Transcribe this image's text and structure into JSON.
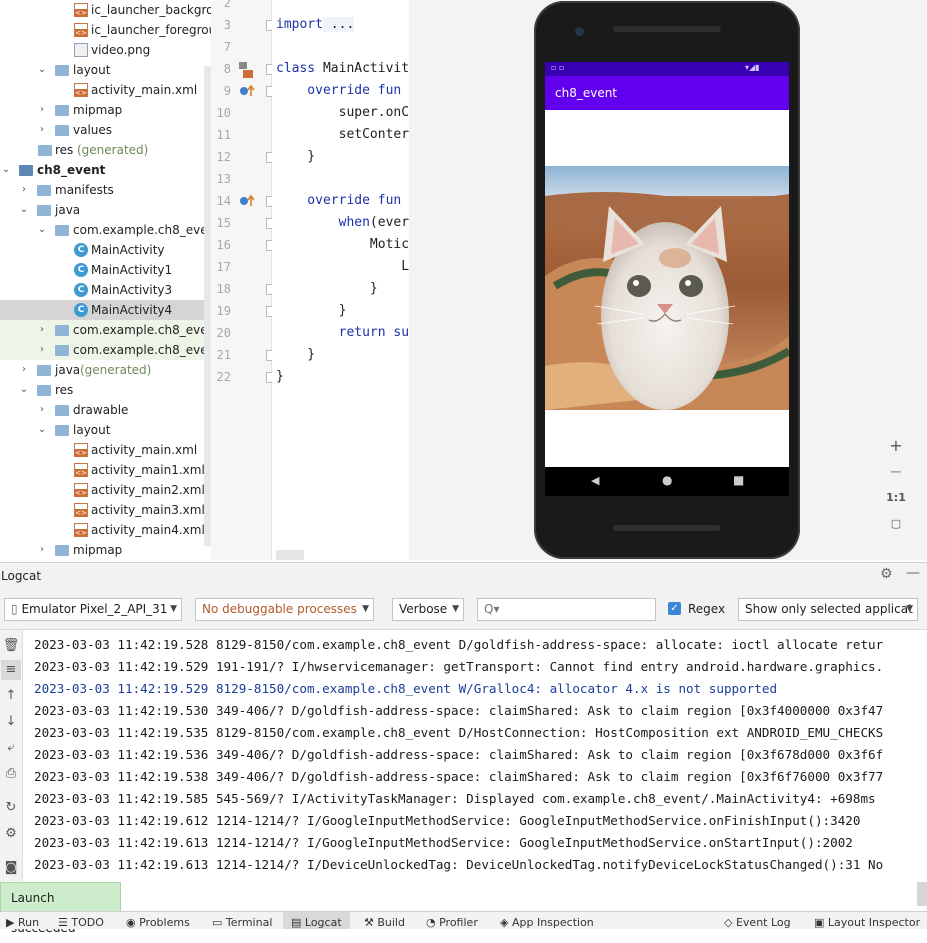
{
  "project_tree": {
    "items": [
      {
        "label": "ic_launcher_backgrou",
        "icon": "xml-icon"
      },
      {
        "label": "ic_launcher_foregroun",
        "icon": "xml-icon"
      },
      {
        "label": "video.png",
        "icon": "png-icon"
      },
      {
        "label": "layout",
        "icon": "folder-icon"
      },
      {
        "label": "activity_main.xml",
        "icon": "xml-icon"
      },
      {
        "label": "mipmap",
        "icon": "folder-icon"
      },
      {
        "label": "values",
        "icon": "folder-icon"
      },
      {
        "label": "res",
        "suffix": "(generated)",
        "icon": "folder-icon"
      },
      {
        "label": "ch8_event",
        "icon": "module-icon"
      },
      {
        "label": "manifests",
        "icon": "folder-icon"
      },
      {
        "label": "java",
        "icon": "folder-icon"
      },
      {
        "label": "com.example.ch8_event",
        "icon": "folder-icon"
      },
      {
        "label": "MainActivity",
        "icon": "class-icon"
      },
      {
        "label": "MainActivity1",
        "icon": "class-icon"
      },
      {
        "label": "MainActivity3",
        "icon": "class-icon"
      },
      {
        "label": "MainActivity4",
        "icon": "class-icon"
      },
      {
        "label": "com.example.ch8_event",
        "suffix": "(",
        "icon": "folder-icon"
      },
      {
        "label": "com.example.ch8_event",
        "suffix": "(",
        "icon": "folder-icon"
      },
      {
        "label": "java",
        "suffix": "(generated)",
        "icon": "folder-icon"
      },
      {
        "label": "res",
        "icon": "folder-icon"
      },
      {
        "label": "drawable",
        "icon": "folder-icon"
      },
      {
        "label": "layout",
        "icon": "folder-icon"
      },
      {
        "label": "activity_main.xml",
        "icon": "xml-icon"
      },
      {
        "label": "activity_main1.xml",
        "icon": "xml-icon"
      },
      {
        "label": "activity_main2.xml",
        "icon": "xml-icon"
      },
      {
        "label": "activity_main3.xml",
        "icon": "xml-icon"
      },
      {
        "label": "activity_main4.xml",
        "icon": "xml-icon"
      },
      {
        "label": "mipmap",
        "icon": "folder-icon"
      }
    ]
  },
  "editor": {
    "line_numbers": [
      "2",
      "3",
      "7",
      "8",
      "9",
      "10",
      "11",
      "12",
      "13",
      "14",
      "15",
      "16",
      "17",
      "18",
      "19",
      "20",
      "21",
      "22"
    ],
    "lines": [
      {
        "kw": "",
        "text": ""
      },
      {
        "kw": "import",
        "text": " ..."
      },
      {
        "kw": "",
        "text": ""
      },
      {
        "kw": "class",
        "text": " MainActivit"
      },
      {
        "kw": "    override fun",
        "text": ""
      },
      {
        "kw": "",
        "text": "        super.onC"
      },
      {
        "kw": "",
        "text": "        setConter"
      },
      {
        "kw": "",
        "text": "    }"
      },
      {
        "kw": "",
        "text": ""
      },
      {
        "kw": "    override fun",
        "text": ""
      },
      {
        "kw": "        when",
        "text": "(ever"
      },
      {
        "kw": "",
        "text": "            Motic"
      },
      {
        "kw": "",
        "text": "                L"
      },
      {
        "kw": "",
        "text": "            }"
      },
      {
        "kw": "",
        "text": "        }"
      },
      {
        "kw": "        return",
        "text": " su"
      },
      {
        "kw": "",
        "text": "    }"
      },
      {
        "kw": "",
        "text": "}"
      }
    ]
  },
  "emulator": {
    "app_title": "ch8_event",
    "zoom_in": "+",
    "zoom_out": "−",
    "zoom_reset": "1:1"
  },
  "logcat": {
    "title": "Logcat",
    "device": "Emulator Pixel_2_API_31",
    "process": "No debuggable processes",
    "level": "Verbose",
    "search_placeholder": "Q▾",
    "regex_label": "Regex",
    "regex_checked": true,
    "filter": "Show only selected applicat",
    "lines": [
      {
        "text": "2023-03-03 11:42:19.528 8129-8150/com.example.ch8_event D/goldfish-address-space: allocate: ioctl allocate retur",
        "level": "D"
      },
      {
        "text": "2023-03-03 11:42:19.529 191-191/? I/hwservicemanager: getTransport: Cannot find entry android.hardware.graphics.",
        "level": "I"
      },
      {
        "text": "2023-03-03 11:42:19.529 8129-8150/com.example.ch8_event W/Gralloc4: allocator 4.x is not supported",
        "level": "W"
      },
      {
        "text": "2023-03-03 11:42:19.530 349-406/? D/goldfish-address-space: claimShared: Ask to claim region [0x3f4000000 0x3f47",
        "level": "D"
      },
      {
        "text": "2023-03-03 11:42:19.535 8129-8150/com.example.ch8_event D/HostConnection: HostComposition ext ANDROID_EMU_CHECKS",
        "level": "D"
      },
      {
        "text": "2023-03-03 11:42:19.536 349-406/? D/goldfish-address-space: claimShared: Ask to claim region [0x3f678d000 0x3f6f",
        "level": "D"
      },
      {
        "text": "2023-03-03 11:42:19.538 349-406/? D/goldfish-address-space: claimShared: Ask to claim region [0x3f6f76000 0x3f77",
        "level": "D"
      },
      {
        "text": "2023-03-03 11:42:19.585 545-569/? I/ActivityTaskManager: Displayed com.example.ch8_event/.MainActivity4: +698ms",
        "level": "I"
      },
      {
        "text": "2023-03-03 11:42:19.612 1214-1214/? I/GoogleInputMethodService: GoogleInputMethodService.onFinishInput():3420",
        "level": "I"
      },
      {
        "text": "2023-03-03 11:42:19.613 1214-1214/? I/GoogleInputMethodService: GoogleInputMethodService.onStartInput():2002",
        "level": "I"
      },
      {
        "text": "2023-03-03 11:42:19.613 1214-1214/? I/DeviceUnlockedTag: DeviceUnlockedTag.notifyDeviceLockStatusChanged():31 No",
        "level": "I"
      }
    ]
  },
  "toast": "Launch succeeded",
  "bottom_tabs": [
    {
      "label": "Run",
      "icon": "run-icon"
    },
    {
      "label": "TODO",
      "icon": "todo-icon"
    },
    {
      "label": "Problems",
      "icon": "problems-icon"
    },
    {
      "label": "Terminal",
      "icon": "terminal-icon"
    },
    {
      "label": "Logcat",
      "icon": "logcat-icon"
    },
    {
      "label": "Build",
      "icon": "build-icon"
    },
    {
      "label": "Profiler",
      "icon": "profiler-icon"
    },
    {
      "label": "App Inspection",
      "icon": "app-inspection-icon"
    },
    {
      "label": "Event Log",
      "icon": "event-log-icon"
    },
    {
      "label": "Layout Inspector",
      "icon": "layout-inspector-icon"
    }
  ],
  "colors": {
    "app_bar": "#6200ee",
    "status_bar": "#3700b3",
    "keyword": "#1d32a8",
    "warning_log": "#1d3d99",
    "toast_bg": "#cdeccb"
  }
}
